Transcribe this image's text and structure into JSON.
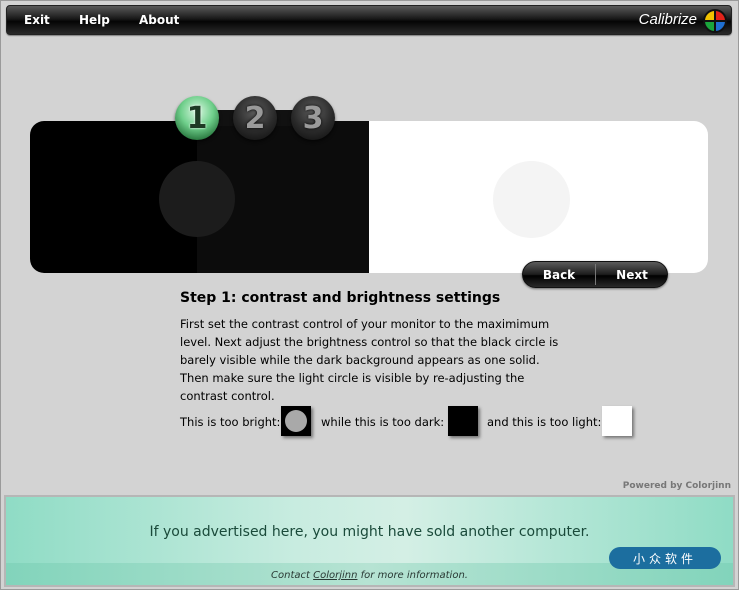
{
  "menu": {
    "exit_label": "Exit",
    "help_label": "Help",
    "about_label": "About",
    "brand": "Calibrize"
  },
  "steps": [
    {
      "label": "1",
      "active": true
    },
    {
      "label": "2",
      "active": false
    },
    {
      "label": "3",
      "active": false
    }
  ],
  "nav": {
    "back_label": "Back",
    "next_label": "Next"
  },
  "content": {
    "title": "Step 1: contrast and brightness settings",
    "body_lines": [
      "First set the contrast control of your monitor to the maximimum",
      "level. Next adjust the brightness control so that the black circle is",
      "barely visible while the dark background appears as one solid.",
      "Then make sure the light circle is visible by re-adjusting the",
      "contrast control."
    ],
    "too_bright_label": "This is too bright:",
    "too_dark_label": "while this is too dark:",
    "too_light_label": "and this is too light:"
  },
  "powered_by": "Powered by Colorjinn",
  "ad": {
    "headline": "If you advertised here, you might have sold another computer.",
    "contact_prefix": "Contact",
    "contact_link": "Colorjinn",
    "contact_suffix": "for more information.",
    "badge": "小众软件"
  },
  "colors": {
    "menubar": "#111111",
    "active_step": "#6fcf8b",
    "ad_background": "#8fdcc5",
    "badge": "#1c6e9f"
  }
}
